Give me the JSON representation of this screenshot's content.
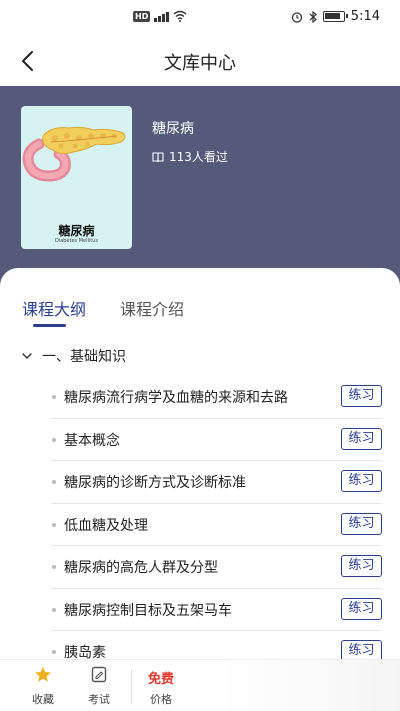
{
  "status_bar": {
    "time": "5:14",
    "hd": "HD"
  },
  "nav": {
    "title": "文库中心"
  },
  "course": {
    "cover_title": "糖尿病",
    "cover_subtitle": "Diabetes Mellitus",
    "name": "糖尿病",
    "views": "113人看过"
  },
  "tabs": [
    {
      "label": "课程大纲",
      "active": true
    },
    {
      "label": "课程介绍",
      "active": false
    }
  ],
  "outline": {
    "section": "一、基础知识",
    "items": [
      {
        "label": "糖尿病流行病学及血糖的来源和去路",
        "action": "练习"
      },
      {
        "label": "基本概念",
        "action": "练习"
      },
      {
        "label": "糖尿病的诊断方式及诊断标准",
        "action": "练习"
      },
      {
        "label": "低血糖及处理",
        "action": "练习"
      },
      {
        "label": "糖尿病的高危人群及分型",
        "action": "练习"
      },
      {
        "label": "糖尿病控制目标及五架马车",
        "action": "练习"
      },
      {
        "label": "胰岛素",
        "action": "练习"
      }
    ]
  },
  "bottom_bar": {
    "favorite": "收藏",
    "exam": "考试",
    "price_value": "免费",
    "price_label": "价格"
  },
  "colors": {
    "accent": "#2a3f8f",
    "banner": "#555a7a",
    "price": "#e03a2f",
    "star": "#f2b01e"
  }
}
